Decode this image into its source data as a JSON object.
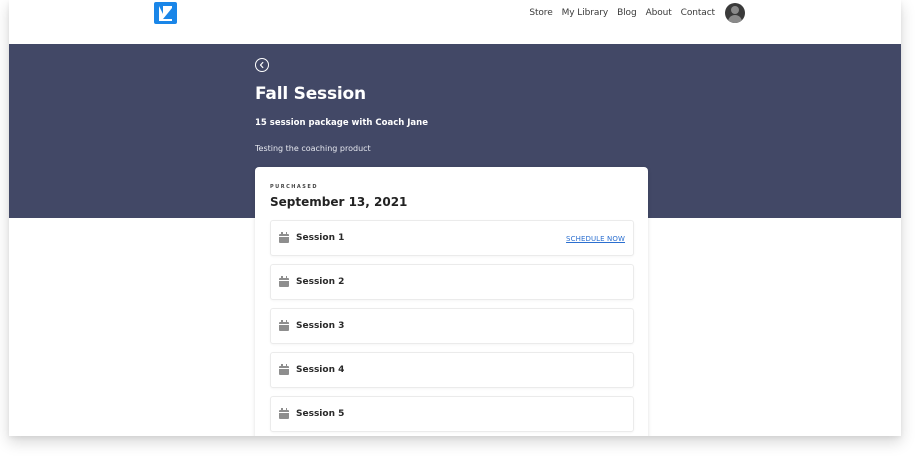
{
  "header": {
    "logo_icon": "kajabi-logo-icon",
    "nav": [
      "Store",
      "My Library",
      "Blog",
      "About",
      "Contact"
    ],
    "avatar_icon": "user-avatar-icon",
    "brand_color": "#1a86e8"
  },
  "hero": {
    "back_icon": "chevron-left-circle-icon",
    "title": "Fall Session",
    "subtitle": "15 session package with Coach Jane",
    "description": "Testing the coaching product",
    "background_color": "#424866"
  },
  "purchase": {
    "label": "PURCHASED",
    "date": "September 13, 2021"
  },
  "sessions": [
    {
      "label": "Session 1",
      "action": "SCHEDULE NOW"
    },
    {
      "label": "Session 2"
    },
    {
      "label": "Session 3"
    },
    {
      "label": "Session 4"
    },
    {
      "label": "Session 5"
    }
  ],
  "icons": {
    "session_icon": "calendar-icon"
  }
}
